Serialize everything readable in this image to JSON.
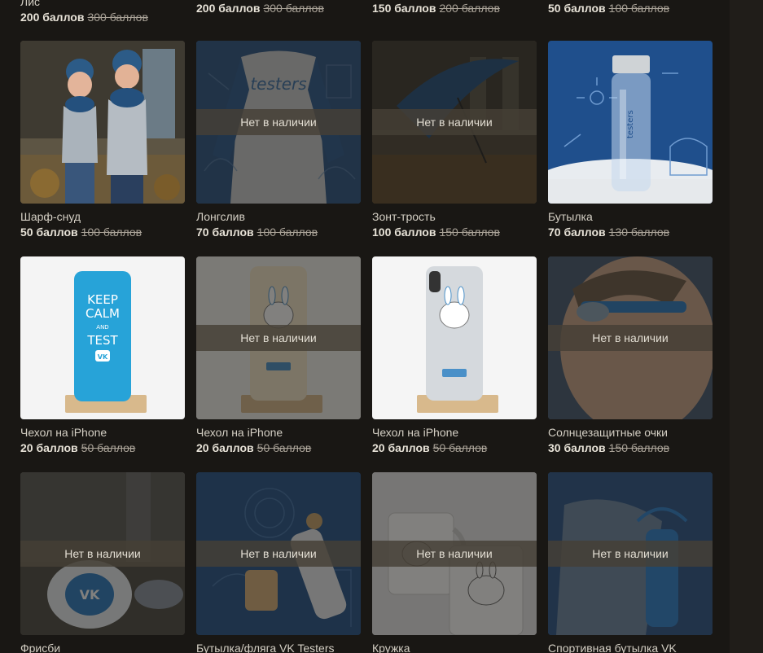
{
  "out_of_stock_label": "Нет в наличии",
  "top_row": [
    {
      "name": "Лис",
      "price": "200 баллов",
      "old_price": "300 баллов"
    },
    {
      "name": "",
      "price": "200 баллов",
      "old_price": "300 баллов"
    },
    {
      "name": "",
      "price": "150 баллов",
      "old_price": "200 баллов"
    },
    {
      "name": "",
      "price": "50 баллов",
      "old_price": "100 баллов"
    }
  ],
  "products": [
    {
      "name": "Шарф-снуд",
      "price": "50 баллов",
      "old_price": "100 баллов",
      "in_stock": true
    },
    {
      "name": "Лонгслив",
      "price": "70 баллов",
      "old_price": "100 баллов",
      "in_stock": false
    },
    {
      "name": "Зонт-трость",
      "price": "100 баллов",
      "old_price": "150 баллов",
      "in_stock": false
    },
    {
      "name": "Бутылка",
      "price": "70 баллов",
      "old_price": "130 баллов",
      "in_stock": true
    },
    {
      "name": "Чехол на iPhone",
      "price": "20 баллов",
      "old_price": "50 баллов",
      "in_stock": true
    },
    {
      "name": "Чехол на iPhone",
      "price": "20 баллов",
      "old_price": "50 баллов",
      "in_stock": false
    },
    {
      "name": "Чехол на iPhone",
      "price": "20 баллов",
      "old_price": "50 баллов",
      "in_stock": true
    },
    {
      "name": "Солнцезащитные очки",
      "price": "30 баллов",
      "old_price": "150 баллов",
      "in_stock": false
    },
    {
      "name": "Фрисби",
      "price": "",
      "old_price": "",
      "in_stock": false
    },
    {
      "name": "Бутылка/фляга VK Testers",
      "price": "",
      "old_price": "",
      "in_stock": false
    },
    {
      "name": "Кружка",
      "price": "",
      "old_price": "",
      "in_stock": false
    },
    {
      "name": "Спортивная бутылка VK",
      "price": "",
      "old_price": "",
      "in_stock": false
    }
  ],
  "case_text": {
    "line1": "KEEP",
    "line2": "CALM",
    "line3": "AND",
    "line4": "TEST"
  },
  "brand_text": "testers",
  "vk_text": "VK"
}
